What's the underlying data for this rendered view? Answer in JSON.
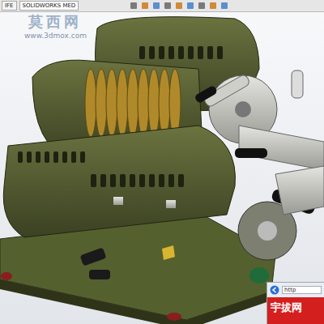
{
  "toolbar": {
    "tabs": [
      {
        "label": "IFE",
        "selected": false
      },
      {
        "label": "SOLIDWORKS MED",
        "selected": true
      }
    ]
  },
  "watermark": {
    "title": "莫西网",
    "url": "www.3dmox.com"
  },
  "browser_popup": {
    "address": "http",
    "banner": "宇拔网"
  }
}
